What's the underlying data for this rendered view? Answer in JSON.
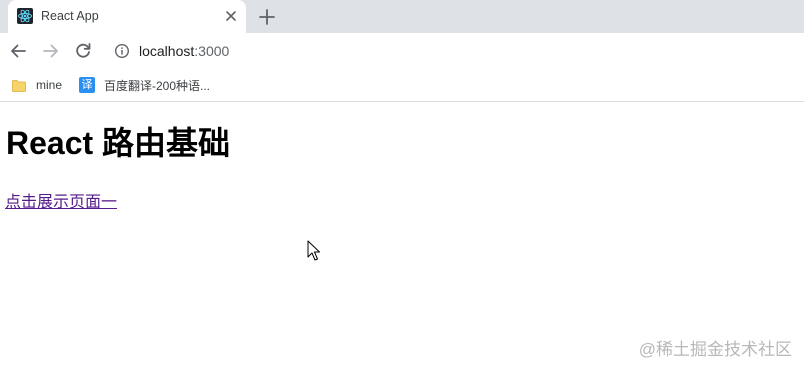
{
  "browser": {
    "tab": {
      "title": "React App",
      "favicon": "react-logo-icon"
    },
    "omnibox": {
      "host": "localhost",
      "port": ":3000"
    },
    "bookmarks": [
      {
        "label": "mine",
        "icon": "folder-icon"
      },
      {
        "label": "百度翻译-200种语...",
        "icon": "translate-icon",
        "icon_glyph": "译"
      }
    ]
  },
  "page": {
    "heading": "React 路由基础",
    "link_text": "点击展示页面一",
    "watermark": "@稀土掘金技术社区"
  },
  "colors": {
    "tabstrip_bg": "#dee1e6",
    "link_visited": "#551a8b",
    "react_cyan": "#61dafb"
  }
}
